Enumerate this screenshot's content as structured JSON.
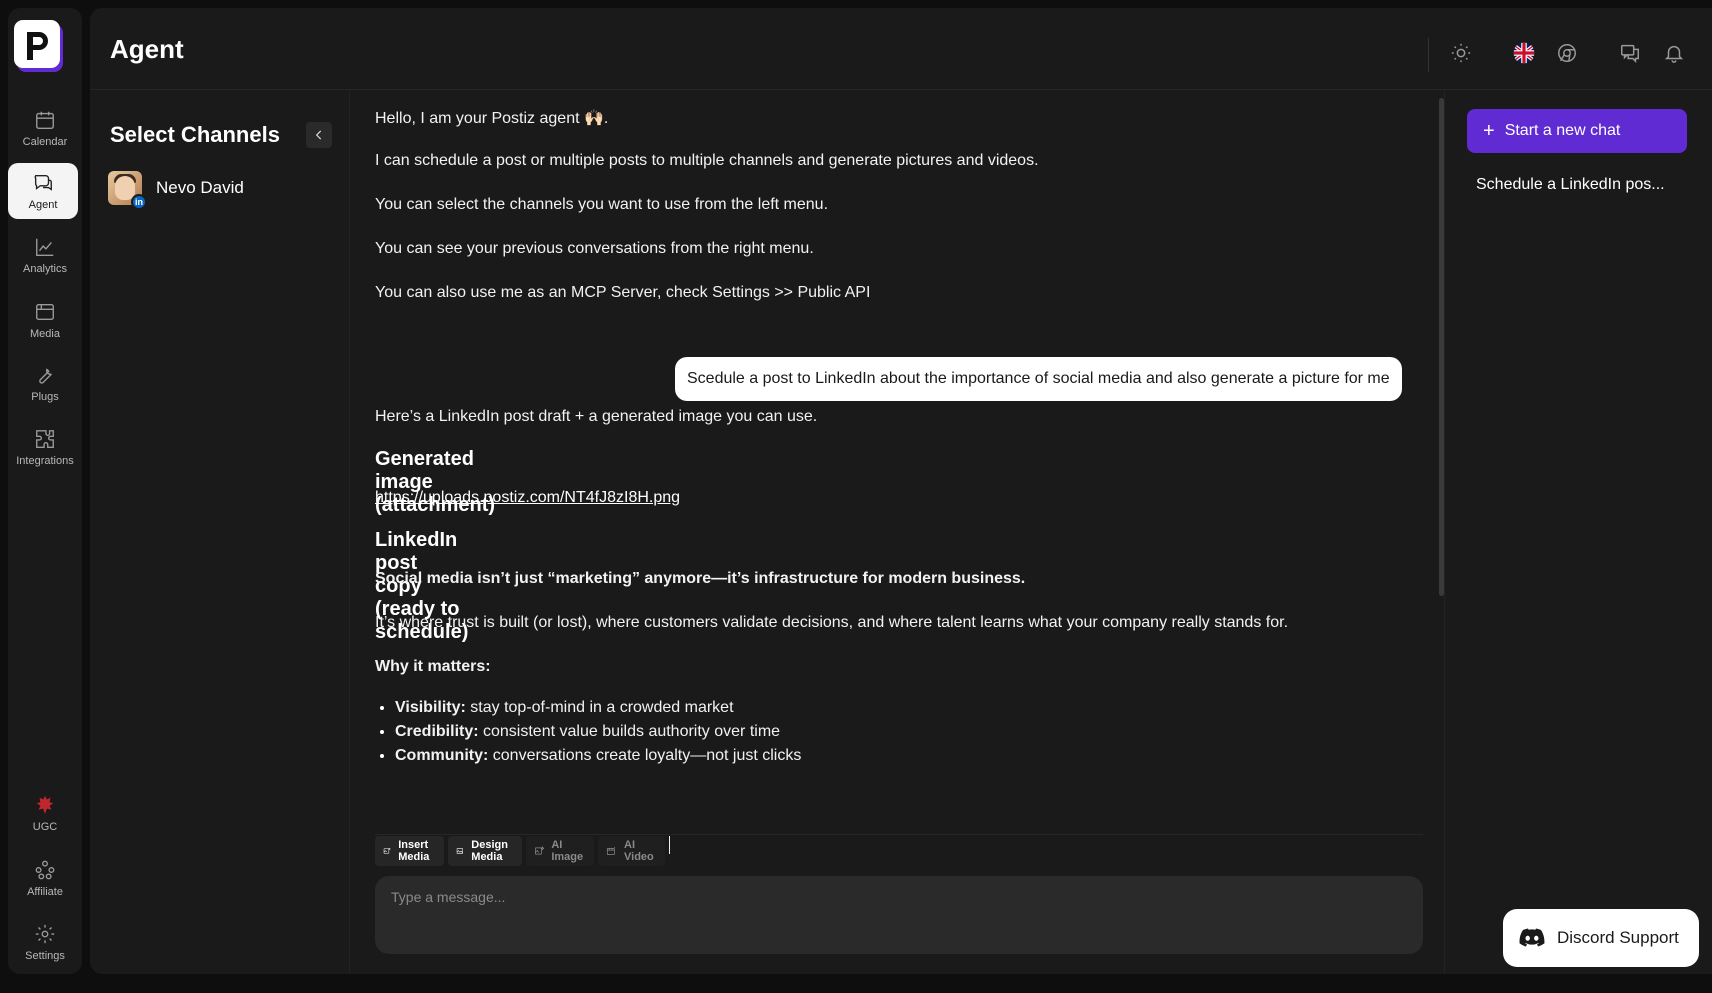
{
  "header": {
    "title": "Agent"
  },
  "nav": {
    "items": [
      {
        "label": "Calendar"
      },
      {
        "label": "Agent"
      },
      {
        "label": "Analytics"
      },
      {
        "label": "Media"
      },
      {
        "label": "Plugs"
      },
      {
        "label": "Integrations"
      },
      {
        "label": "UGC"
      },
      {
        "label": "Affiliate"
      },
      {
        "label": "Settings"
      }
    ]
  },
  "channels": {
    "title": "Select Channels",
    "items": [
      {
        "name": "Nevo David",
        "network_badge": "in"
      }
    ]
  },
  "chat": {
    "intro": [
      "Hello, I am your Postiz agent 🙌🏻.",
      "I can schedule a post or multiple posts to multiple channels and generate pictures and videos.",
      "You can select the channels you want to use from the left menu.",
      "You can see your previous conversations from the right menu.",
      "You can also use me as an MCP Server, check Settings >> Public API"
    ],
    "user_message": "Scedule a post to LinkedIn about the importance of social media and also generate a picture for me",
    "reply": {
      "lead": "Here’s a LinkedIn post draft + a generated image you can use.",
      "h_image": "Generated image (attachment)",
      "image_link": "https://uploads.postiz.com/NT4fJ8zI8H.png",
      "h_copy": "LinkedIn post copy (ready to schedule)",
      "bold_line": "Social media isn’t just “marketing” anymore—it’s infrastructure for modern business.",
      "paragraph": "It’s where trust is built (or lost), where customers validate decisions, and where talent learns what your company really stands for.",
      "why": "Why it matters:",
      "bullets": [
        {
          "term": "Visibility:",
          "text": " stay top-of-mind in a crowded market"
        },
        {
          "term": "Credibility:",
          "text": " consistent value builds authority over time"
        },
        {
          "term": "Community:",
          "text": " conversations create loyalty—not just clicks"
        }
      ]
    },
    "toolbar": {
      "insert_media": "Insert Media",
      "design_media": "Design Media",
      "ai_image": "AI Image",
      "ai_video": "AI Video"
    },
    "composer": {
      "placeholder": "Type a message..."
    }
  },
  "history": {
    "new_chat": "Start a new chat",
    "items": [
      "Schedule a LinkedIn pos..."
    ]
  },
  "support": {
    "discord": "Discord Support"
  },
  "colors": {
    "accent": "#612bd3",
    "background": "#0e0e0e",
    "panel": "#1a1a1a"
  }
}
